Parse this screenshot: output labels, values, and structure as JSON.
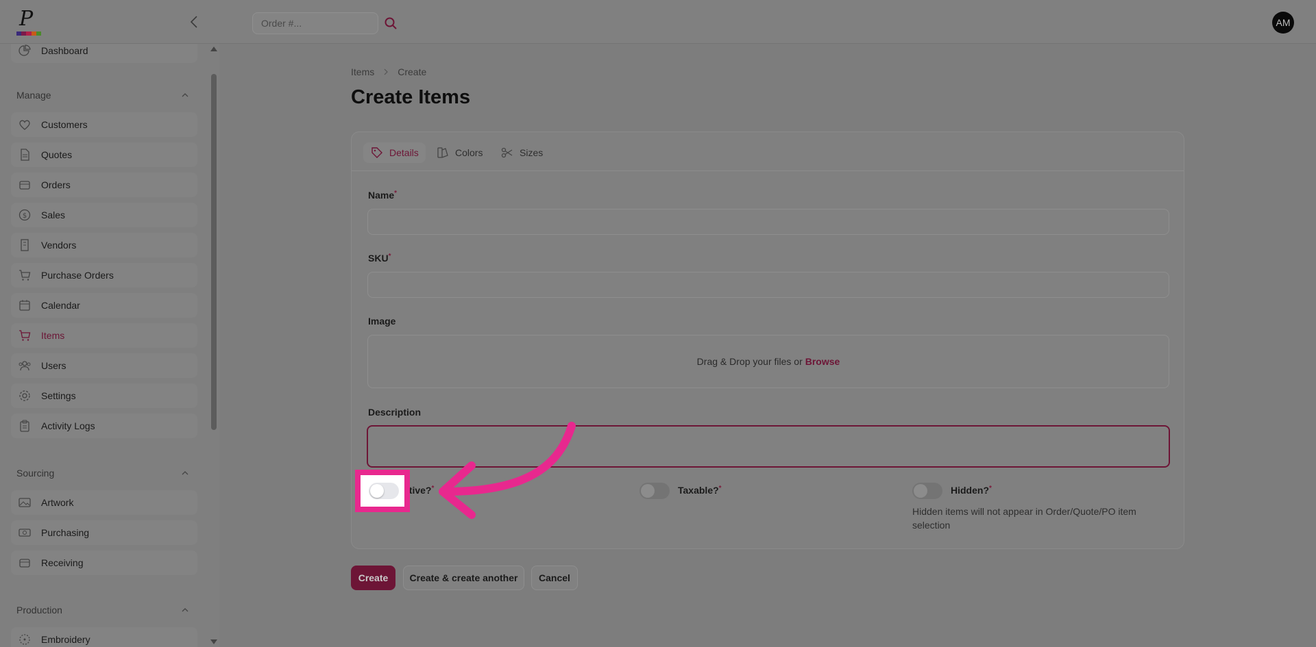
{
  "header": {
    "search_placeholder": "Order #...",
    "avatar_initials": "AM"
  },
  "sidebar": {
    "top_item": "Dashboard",
    "groups": {
      "manage": "Manage",
      "sourcing": "Sourcing",
      "production": "Production"
    },
    "manage_items": [
      "Customers",
      "Quotes",
      "Orders",
      "Sales",
      "Vendors",
      "Purchase Orders",
      "Calendar",
      "Items",
      "Users",
      "Settings",
      "Activity Logs"
    ],
    "sourcing_items": [
      "Artwork",
      "Purchasing",
      "Receiving"
    ],
    "production_items": [
      "Embroidery"
    ],
    "active_item": "Items"
  },
  "breadcrumb": {
    "root": "Items",
    "current": "Create"
  },
  "page": {
    "title": "Create Items"
  },
  "tabs": {
    "details": "Details",
    "colors": "Colors",
    "sizes": "Sizes"
  },
  "form": {
    "name_label": "Name",
    "sku_label": "SKU",
    "image_label": "Image",
    "dropzone_text": "Drag & Drop your files or",
    "dropzone_browse": "Browse",
    "description_label": "Description",
    "required_mark": "*",
    "active_label": "ctive?",
    "taxable_label": "Taxable?",
    "hidden_label": "Hidden?",
    "hidden_hint": "Hidden items will not appear in Order/Quote/PO item selection"
  },
  "actions": {
    "create": "Create",
    "create_another": "Create & create another",
    "cancel": "Cancel"
  },
  "colors": {
    "accent": "#6d1536",
    "highlight": "#e8288e"
  }
}
